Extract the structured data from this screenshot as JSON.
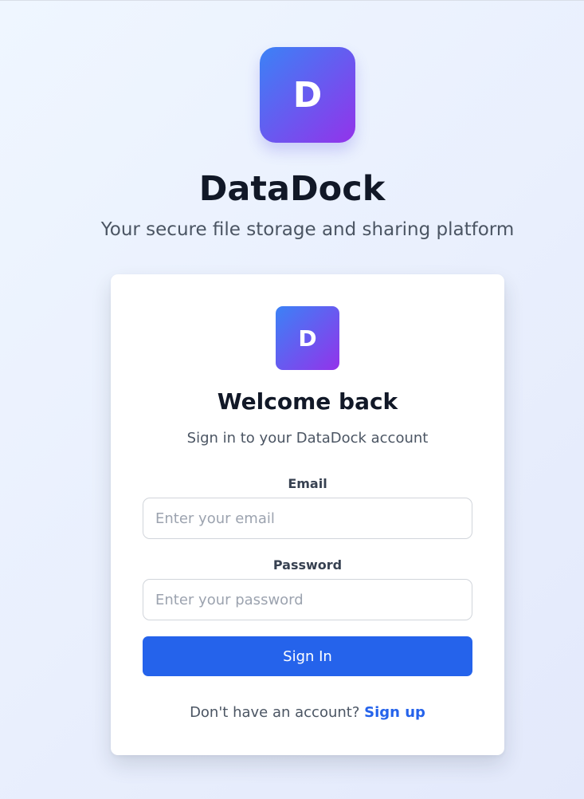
{
  "brand": {
    "logo_letter": "D",
    "name": "DataDock",
    "tagline": "Your secure file storage and sharing platform"
  },
  "login_card": {
    "logo_letter": "D",
    "heading": "Welcome back",
    "subheading": "Sign in to your DataDock account",
    "email": {
      "label": "Email",
      "placeholder": "Enter your email",
      "value": ""
    },
    "password": {
      "label": "Password",
      "placeholder": "Enter your password",
      "value": ""
    },
    "submit_label": "Sign In",
    "signup_prompt": "Don't have an account?",
    "signup_link": "Sign up"
  },
  "colors": {
    "logo_gradient_start": "#3b82f6",
    "logo_gradient_end": "#9333ea",
    "primary_button": "#2563eb",
    "link": "#2563eb"
  }
}
